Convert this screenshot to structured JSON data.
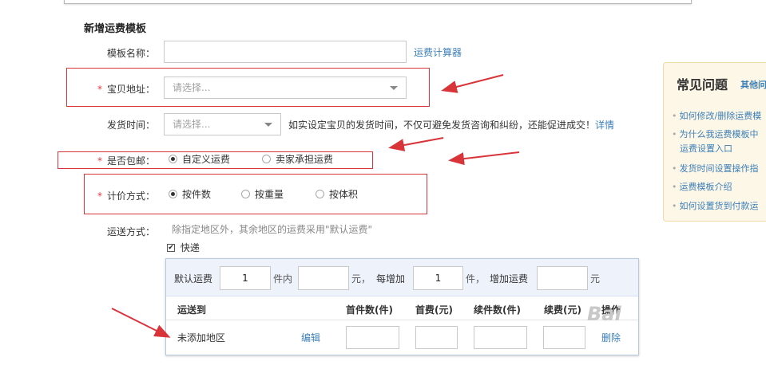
{
  "form": {
    "section_title": "新增运费模板",
    "template_name_label": "模板名称：",
    "calculator_link": "运费计算器",
    "required_mark": "*",
    "location_label": "宝贝地址：",
    "location_placeholder": "请选择...",
    "ship_time_label": "发货时间：",
    "ship_time_placeholder": "请选择...",
    "ship_time_hint": "如实设定宝贝的发货时间，不仅可避免发货咨询和纠纷，还能促进成交！",
    "ship_time_link": "详情",
    "free_shipping_label": "是否包邮：",
    "free_shipping_options": [
      {
        "label": "自定义运费",
        "selected": true
      },
      {
        "label": "卖家承担运费",
        "selected": false
      }
    ],
    "pricing_label": "计价方式：",
    "pricing_options": [
      {
        "label": "按件数",
        "selected": true
      },
      {
        "label": "按重量",
        "selected": false
      },
      {
        "label": "按体积",
        "selected": false
      }
    ],
    "shipping_method_label": "运送方式：",
    "shipping_method_hint": "除指定地区外，其余地区的运费采用\"默认运费\"",
    "express_label": "快递",
    "express_checked": true
  },
  "panel": {
    "default_fee_label": "默认运费",
    "default_qty": "1",
    "qty_unit_within": "件内",
    "default_fee_value": "",
    "yuan_1": "元，",
    "each_add_label": "每增加",
    "each_add_value": "1",
    "piece_unit": "件，",
    "add_fee_label": "增加运费",
    "add_fee_value": "",
    "yuan_2": "元",
    "table_headers": [
      "运送到",
      "首件数(件)",
      "首费(元)",
      "续件数(件)",
      "续费(元)",
      "操作"
    ],
    "row": {
      "region": "未添加地区",
      "edit_link": "编辑",
      "delete_link": "删除"
    }
  },
  "faq": {
    "title": "常见问题",
    "other_link": "其他问",
    "items": [
      "如何修改/删除运费模",
      "为什么我运费模板中",
      "运费设置入口",
      "发货时间设置操作指",
      "运费模板介绍",
      "如何设置货到付款运"
    ]
  },
  "watermark": "Bai",
  "colors": {
    "required": "#e4393c",
    "link": "#3c7fb8",
    "annotation_red": "#d9343a",
    "faq_bg": "#fdf7e8"
  }
}
